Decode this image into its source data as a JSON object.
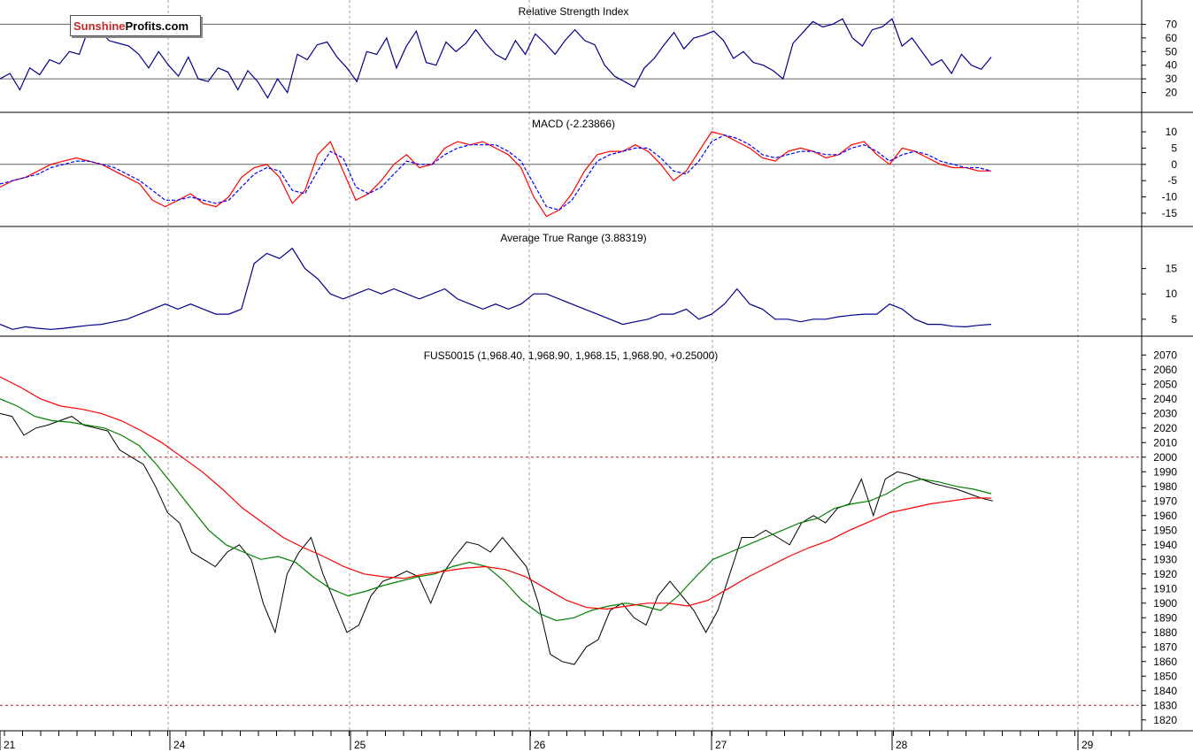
{
  "brand": {
    "part1": "Sunshine",
    "part2": "Profits.com"
  },
  "colors": {
    "price": "#000000",
    "sma_fast": "#008000",
    "sma_slow": "#ff0000",
    "indicator": "#00008b",
    "macd_signal": "#0000ff",
    "dotted_ref": "#b22222",
    "grid": "#a0a0a0"
  },
  "chart_data": [
    {
      "type": "line",
      "title": "Relative Strength Index",
      "ylim": [
        10,
        80
      ],
      "y_ticks": [
        "70",
        "60",
        "50",
        "40",
        "30",
        "20"
      ],
      "reference_lines": [
        70,
        30
      ],
      "series": [
        {
          "values": [
            30,
            34,
            22,
            38,
            33,
            44,
            41,
            50,
            48,
            68,
            66,
            58,
            56,
            54,
            48,
            38,
            50,
            40,
            32,
            46,
            30,
            28,
            38,
            35,
            22,
            36,
            28,
            16,
            30,
            20,
            48,
            44,
            55,
            57,
            46,
            38,
            28,
            50,
            48,
            60,
            38,
            54,
            65,
            42,
            40,
            57,
            50,
            56,
            66,
            56,
            48,
            44,
            58,
            48,
            63,
            56,
            48,
            58,
            66,
            58,
            55,
            40,
            32,
            28,
            24,
            38,
            45,
            55,
            64,
            52,
            60,
            62,
            65,
            58,
            45,
            50,
            42,
            40,
            36,
            30,
            56,
            64,
            72,
            68,
            70,
            74,
            60,
            54,
            66,
            68,
            74,
            54,
            60,
            50,
            40,
            44,
            34,
            48,
            40,
            37,
            46
          ]
        }
      ]
    },
    {
      "type": "line",
      "title": "MACD (-2.23866)",
      "ylim": [
        -18,
        13
      ],
      "y_ticks": [
        "10",
        "5",
        "0",
        "-5",
        "-10",
        "-15"
      ],
      "reference_lines": [
        0
      ],
      "series": [
        {
          "values": [
            -7,
            -5,
            -4,
            -2,
            0,
            1,
            2,
            1,
            0,
            -2,
            -4,
            -6,
            -11,
            -13,
            -11,
            -9,
            -12,
            -13,
            -10,
            -4,
            -1,
            0,
            -4,
            -12,
            -8,
            3,
            7,
            -2,
            -11,
            -9,
            -5,
            0,
            3,
            -1,
            0,
            5,
            7,
            6,
            7,
            5,
            3,
            -1,
            -10,
            -16,
            -14,
            -9,
            -2,
            3,
            4,
            4,
            6,
            4,
            0,
            -5,
            -2,
            4,
            10,
            9,
            7,
            5,
            2,
            1,
            4,
            5,
            4,
            2,
            3,
            6,
            7,
            3,
            0,
            5,
            4,
            2,
            0,
            -1,
            -1,
            -2,
            -2
          ]
        },
        {
          "values": [
            -6,
            -5,
            -4,
            -3,
            -1,
            0,
            1,
            1,
            0,
            -1,
            -3,
            -5,
            -8,
            -11,
            -11,
            -10,
            -11,
            -12,
            -11,
            -7,
            -3,
            -1,
            -2,
            -8,
            -9,
            -2,
            4,
            2,
            -7,
            -9,
            -7,
            -3,
            1,
            0,
            0,
            3,
            5,
            6,
            6,
            6,
            4,
            1,
            -6,
            -13,
            -14,
            -11,
            -5,
            1,
            3,
            4,
            5,
            5,
            2,
            -2,
            -3,
            1,
            7,
            9,
            8,
            6,
            3,
            2,
            3,
            4,
            4,
            3,
            3,
            5,
            6,
            4,
            1,
            3,
            4,
            3,
            1,
            0,
            -1,
            -1,
            -2
          ]
        }
      ]
    },
    {
      "type": "line",
      "title": "Average True Range (3.88319)",
      "ylim": [
        2,
        20
      ],
      "y_ticks": [
        "15",
        "10",
        "5"
      ],
      "series": [
        {
          "values": [
            4,
            3,
            3.5,
            3.2,
            3,
            3.2,
            3.5,
            3.8,
            4,
            4.5,
            5,
            6,
            7,
            8,
            7,
            8,
            7,
            6,
            6,
            7,
            16,
            18,
            17,
            19,
            15,
            13,
            10,
            9,
            10,
            11,
            10,
            11,
            10,
            9,
            10,
            11,
            9,
            8,
            7,
            8,
            7,
            8,
            10,
            10,
            9,
            8,
            7,
            6,
            5,
            4,
            4.5,
            5,
            6,
            6,
            7,
            5,
            6,
            8,
            11,
            8,
            7,
            5,
            5,
            4.5,
            5,
            5,
            5.5,
            5.8,
            6,
            6,
            8,
            7,
            5,
            4,
            4,
            3.6,
            3.5,
            3.8,
            4
          ]
        }
      ]
    },
    {
      "type": "line",
      "title": "FUS50015 (1,968.40, 1,968.90, 1,968.15, 1,968.90, +0.25000)",
      "ylim": [
        1815,
        2075
      ],
      "y_ticks": [
        "2070",
        "2060",
        "2050",
        "2040",
        "2030",
        "2020",
        "2010",
        "2000",
        "1990",
        "1980",
        "1970",
        "1960",
        "1950",
        "1940",
        "1930",
        "1920",
        "1910",
        "1900",
        "1890",
        "1880",
        "1870",
        "1860",
        "1850",
        "1840",
        "1830",
        "1820"
      ],
      "reference_lines": [
        2000,
        1830
      ],
      "x_labels": [
        "21",
        "24",
        "25",
        "26",
        "27",
        "28",
        "29"
      ],
      "series": [
        {
          "values": [
            2030,
            2028,
            2015,
            2020,
            2022,
            2025,
            2028,
            2022,
            2020,
            2018,
            2005,
            2000,
            1995,
            1980,
            1962,
            1955,
            1935,
            1930,
            1925,
            1935,
            1940,
            1930,
            1900,
            1880,
            1920,
            1935,
            1945,
            1920,
            1900,
            1880,
            1885,
            1905,
            1915,
            1918,
            1922,
            1918,
            1900,
            1920,
            1932,
            1942,
            1940,
            1935,
            1945,
            1935,
            1925,
            1900,
            1865,
            1860,
            1858,
            1870,
            1875,
            1895,
            1900,
            1890,
            1885,
            1905,
            1915,
            1905,
            1895,
            1880,
            1895,
            1920,
            1945,
            1945,
            1950,
            1945,
            1940,
            1955,
            1960,
            1955,
            1965,
            1968,
            1985,
            1960,
            1985,
            1990,
            1988,
            1985,
            1982,
            1980,
            1978,
            1975,
            1972,
            1970
          ]
        },
        {
          "values": [
            2040,
            2035,
            2028,
            2025,
            2024,
            2022,
            2020,
            2015,
            2008,
            1995,
            1980,
            1965,
            1950,
            1940,
            1935,
            1930,
            1932,
            1928,
            1918,
            1910,
            1905,
            1908,
            1912,
            1915,
            1918,
            1920,
            1925,
            1928,
            1925,
            1915,
            1902,
            1893,
            1888,
            1890,
            1895,
            1898,
            1900,
            1898,
            1895,
            1905,
            1918,
            1930,
            1935,
            1940,
            1945,
            1950,
            1955,
            1958,
            1965,
            1968,
            1970,
            1975,
            1982,
            1985,
            1983,
            1980,
            1978,
            1975
          ]
        },
        {
          "values": [
            2055,
            2048,
            2040,
            2035,
            2033,
            2030,
            2025,
            2018,
            2010,
            2000,
            1990,
            1978,
            1965,
            1955,
            1945,
            1938,
            1932,
            1925,
            1920,
            1918,
            1917,
            1920,
            1922,
            1924,
            1925,
            1923,
            1918,
            1910,
            1902,
            1897,
            1896,
            1898,
            1900,
            1900,
            1898,
            1902,
            1910,
            1918,
            1925,
            1932,
            1938,
            1943,
            1950,
            1956,
            1962,
            1965,
            1968,
            1970,
            1972,
            1972
          ]
        }
      ]
    }
  ]
}
